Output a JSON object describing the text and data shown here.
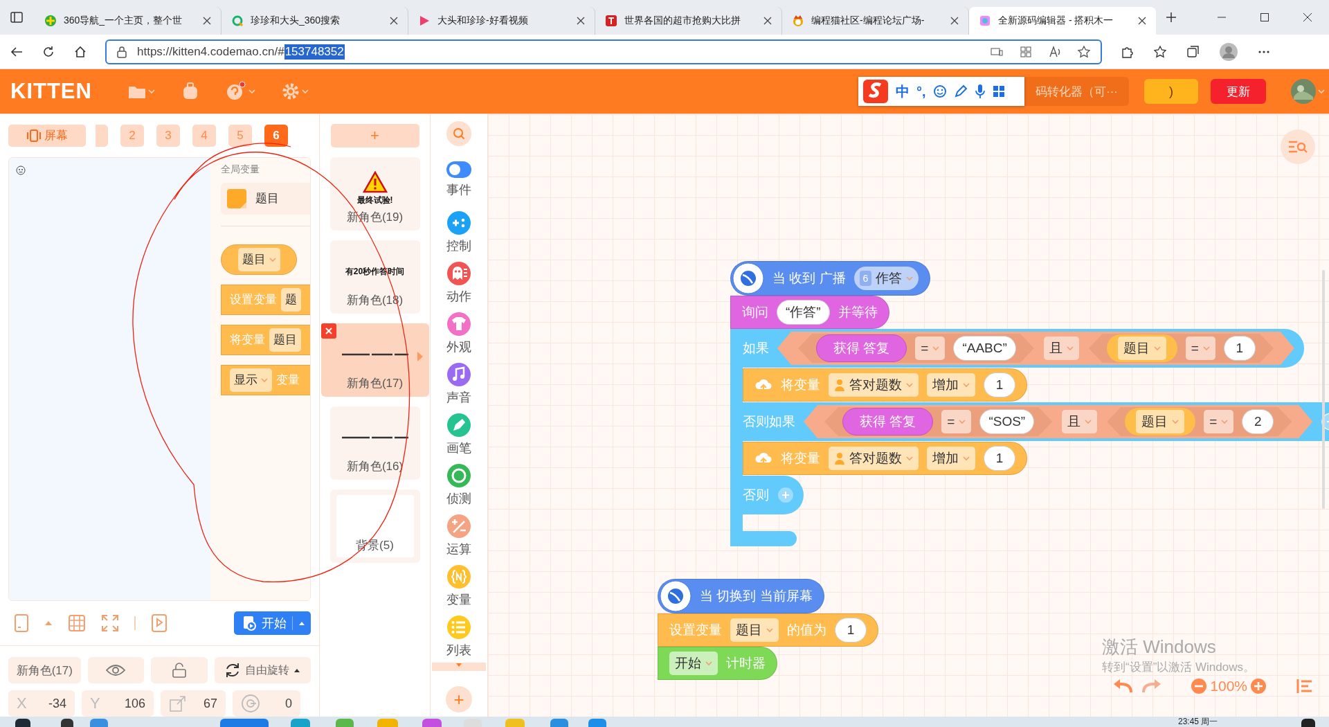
{
  "browser": {
    "tabs": [
      {
        "title": "360导航_一个主页，整个世",
        "selected": false
      },
      {
        "title": "珍珍和大头_360搜索",
        "selected": false
      },
      {
        "title": "大头和珍珍-好看视频",
        "selected": false
      },
      {
        "title": "世界各国的超市抢购大比拼",
        "selected": false
      },
      {
        "title": "编程猫社区-编程论坛广场-",
        "selected": false
      },
      {
        "title": "全新源码编辑器 - 搭积木一",
        "selected": true
      }
    ],
    "address": {
      "url": "https://kitten4.codemao.cn/#",
      "selected_part": "153748352"
    }
  },
  "app_bar": {
    "logo": "KITTEN",
    "ime": {
      "mode": "中",
      "punctuation": "°,"
    },
    "converter_button": "码转化器（可···",
    "yellow_button": ")",
    "update_button": "更新"
  },
  "screens": {
    "button": "屏幕",
    "tabs": [
      {
        "label": "2",
        "selected": false
      },
      {
        "label": "3",
        "selected": false
      },
      {
        "label": "4",
        "selected": false
      },
      {
        "label": "5",
        "selected": false
      },
      {
        "label": "6",
        "selected": true
      }
    ]
  },
  "stage": {
    "variables_panel": {
      "title": "全局变量",
      "variables": [
        {
          "name": "题目"
        }
      ],
      "blocks": [
        {
          "kind": "reporter",
          "value": "题目"
        },
        {
          "kind": "set",
          "label": "设置变量",
          "value": "题"
        },
        {
          "kind": "change",
          "label": "将变量",
          "value": "题目"
        },
        {
          "kind": "show",
          "value": "显示",
          "label": "变量"
        }
      ]
    },
    "start_button": "开始"
  },
  "sprite_info": {
    "name": "新角色(17)",
    "rotation": "自由旋转",
    "fields": [
      {
        "kind": "label",
        "label": "X",
        "value": "-34"
      },
      {
        "kind": "label",
        "label": "Y",
        "value": "106"
      },
      {
        "kind": "size",
        "value": "67"
      },
      {
        "kind": "direction",
        "value": "0"
      }
    ]
  },
  "sprites": {
    "add_button": "+",
    "items": [
      {
        "name": "新角色(19)",
        "selected": false,
        "thumbnail": {
          "kind": "warning",
          "text": "最终试验!"
        }
      },
      {
        "name": "新角色(18)",
        "selected": false,
        "thumbnail": {
          "kind": "text",
          "text": "有20秒作答时间"
        }
      },
      {
        "name": "新角色(17)",
        "selected": true,
        "thumbnail": {
          "kind": "lines"
        }
      },
      {
        "name": "新角色(16)",
        "selected": false,
        "thumbnail": {
          "kind": "lines"
        }
      },
      {
        "name": "背景(5)",
        "selected": false,
        "thumbnail": {
          "kind": "blank"
        }
      }
    ]
  },
  "categories": {
    "items": [
      {
        "label": "事件",
        "kind": "event"
      },
      {
        "label": "控制",
        "kind": "control"
      },
      {
        "label": "动作",
        "kind": "motion"
      },
      {
        "label": "外观",
        "kind": "looks"
      },
      {
        "label": "声音",
        "kind": "sound"
      },
      {
        "label": "画笔",
        "kind": "pen"
      },
      {
        "label": "侦测",
        "kind": "sensing"
      },
      {
        "label": "运算",
        "kind": "operator"
      },
      {
        "label": "变量",
        "kind": "variable"
      },
      {
        "label": "列表",
        "kind": "list"
      }
    ],
    "add_button": "+"
  },
  "canvas": {
    "scripts": [
      {
        "blocks": [
          {
            "kind": "hat",
            "color": "#5a8df0",
            "parts": [
              {
                "kind": "label",
                "text": "当 收到 广播"
              },
              {
                "kind": "dropdown",
                "badge": "6",
                "text": "作答"
              }
            ]
          },
          {
            "kind": "stack",
            "color": "#e065e0",
            "parts": [
              {
                "kind": "label",
                "text": "询问"
              },
              {
                "kind": "string",
                "text": "“作答”"
              },
              {
                "kind": "label",
                "text": "并等待"
              }
            ]
          },
          {
            "kind": "if",
            "color": "#62cbfb",
            "branches": [
              {
                "label": "如果",
                "removable": false,
                "addable": false,
                "condition": {
                  "op": "且",
                  "left": [
                    {
                      "kind": "reporter",
                      "text": "获得 答复"
                    },
                    {
                      "kind": "dropdown",
                      "text": "="
                    },
                    {
                      "kind": "string",
                      "text": "“AABC”"
                    }
                  ],
                  "right": [
                    {
                      "kind": "variable",
                      "text": "题目"
                    },
                    {
                      "kind": "dropdown",
                      "text": "="
                    },
                    {
                      "kind": "number",
                      "text": "1"
                    }
                  ]
                },
                "body": [
                  {
                    "kind": "stack",
                    "color": "#ffbb4d",
                    "cloud": true,
                    "parts": [
                      {
                        "kind": "label",
                        "text": "将变量"
                      },
                      {
                        "kind": "dropdown",
                        "person": true,
                        "text": "答对题数"
                      },
                      {
                        "kind": "dropdown",
                        "text": "增加"
                      },
                      {
                        "kind": "number",
                        "text": "1"
                      }
                    ]
                  }
                ]
              },
              {
                "label": "否则如果",
                "removable": true,
                "addable": false,
                "condition": {
                  "op": "且",
                  "left": [
                    {
                      "kind": "reporter",
                      "text": "获得 答复"
                    },
                    {
                      "kind": "dropdown",
                      "text": "="
                    },
                    {
                      "kind": "string",
                      "text": "“SOS”"
                    }
                  ],
                  "right": [
                    {
                      "kind": "variable",
                      "text": "题目"
                    },
                    {
                      "kind": "dropdown",
                      "text": "="
                    },
                    {
                      "kind": "number",
                      "text": "2"
                    }
                  ]
                },
                "body": [
                  {
                    "kind": "stack",
                    "color": "#ffbb4d",
                    "cloud": true,
                    "parts": [
                      {
                        "kind": "label",
                        "text": "将变量"
                      },
                      {
                        "kind": "dropdown",
                        "person": true,
                        "text": "答对题数"
                      },
                      {
                        "kind": "dropdown",
                        "text": "增加"
                      },
                      {
                        "kind": "number",
                        "text": "1"
                      }
                    ]
                  }
                ]
              },
              {
                "label": "否则",
                "removable": false,
                "addable": true
              }
            ]
          }
        ]
      },
      {
        "blocks": [
          {
            "kind": "hat",
            "color": "#5a8df0",
            "parts": [
              {
                "kind": "label",
                "text": "当 切换到 当前屏幕"
              }
            ]
          },
          {
            "kind": "stack",
            "color": "#ffbb4d",
            "parts": [
              {
                "kind": "label",
                "text": "设置变量"
              },
              {
                "kind": "dropdown",
                "text": "题目"
              },
              {
                "kind": "label",
                "text": "的值为"
              },
              {
                "kind": "number",
                "text": "1"
              }
            ]
          },
          {
            "kind": "stack",
            "color": "#7ed957",
            "parts": [
              {
                "kind": "dropdown",
                "text": "开始"
              },
              {
                "kind": "label",
                "text": "计时器"
              }
            ]
          }
        ]
      }
    ],
    "zoom": "100%"
  },
  "os_notice": {
    "title": "激活 Windows",
    "text": "转到“设置”以激活 Windows。"
  },
  "taskbar": {
    "clock": "23:45 周一"
  }
}
